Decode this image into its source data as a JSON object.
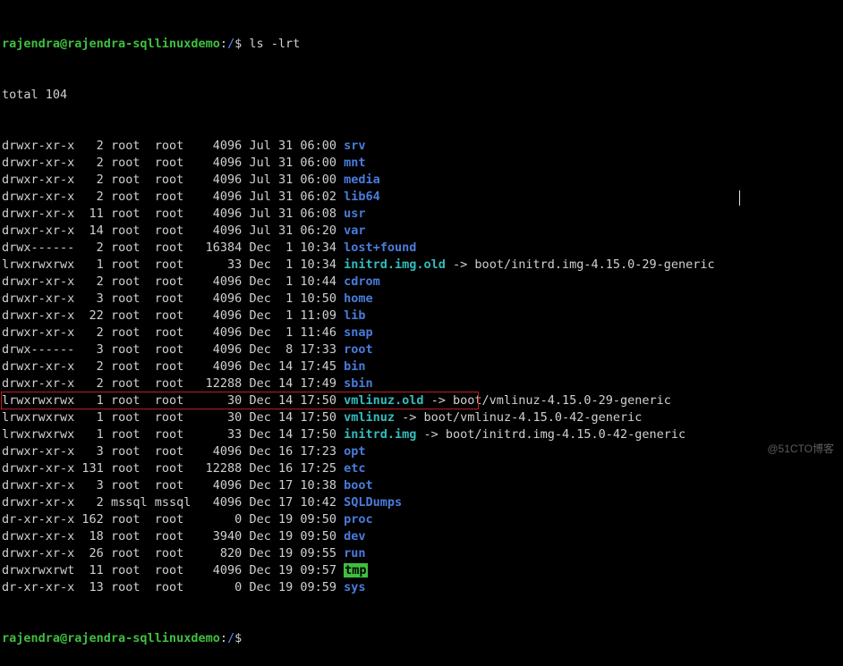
{
  "prompt": {
    "user_host": "rajendra@rajendra-sqllinuxdemo",
    "separator": ":",
    "path": "/",
    "dollar": "$",
    "command": "ls -lrt"
  },
  "total_line": "total 104",
  "rows": [
    {
      "perm": "drwxr-xr-x",
      "links": "  2",
      "owner": "root ",
      "group": "root ",
      "size": "  4096",
      "date": "Jul 31 06:00",
      "name": "srv",
      "cls": "blue"
    },
    {
      "perm": "drwxr-xr-x",
      "links": "  2",
      "owner": "root ",
      "group": "root ",
      "size": "  4096",
      "date": "Jul 31 06:00",
      "name": "mnt",
      "cls": "blue"
    },
    {
      "perm": "drwxr-xr-x",
      "links": "  2",
      "owner": "root ",
      "group": "root ",
      "size": "  4096",
      "date": "Jul 31 06:00",
      "name": "media",
      "cls": "blue"
    },
    {
      "perm": "drwxr-xr-x",
      "links": "  2",
      "owner": "root ",
      "group": "root ",
      "size": "  4096",
      "date": "Jul 31 06:02",
      "name": "lib64",
      "cls": "blue"
    },
    {
      "perm": "drwxr-xr-x",
      "links": " 11",
      "owner": "root ",
      "group": "root ",
      "size": "  4096",
      "date": "Jul 31 06:08",
      "name": "usr",
      "cls": "blue"
    },
    {
      "perm": "drwxr-xr-x",
      "links": " 14",
      "owner": "root ",
      "group": "root ",
      "size": "  4096",
      "date": "Jul 31 06:20",
      "name": "var",
      "cls": "blue"
    },
    {
      "perm": "drwx------",
      "links": "  2",
      "owner": "root ",
      "group": "root ",
      "size": " 16384",
      "date": "Dec  1 10:34",
      "name": "lost+found",
      "cls": "blue"
    },
    {
      "perm": "lrwxrwxrwx",
      "links": "  1",
      "owner": "root ",
      "group": "root ",
      "size": "    33",
      "date": "Dec  1 10:34",
      "name": "initrd.img.old",
      "cls": "cyan",
      "arrow": " -> boot/initrd.img-4.15.0-29-generic"
    },
    {
      "perm": "drwxr-xr-x",
      "links": "  2",
      "owner": "root ",
      "group": "root ",
      "size": "  4096",
      "date": "Dec  1 10:44",
      "name": "cdrom",
      "cls": "blue"
    },
    {
      "perm": "drwxr-xr-x",
      "links": "  3",
      "owner": "root ",
      "group": "root ",
      "size": "  4096",
      "date": "Dec  1 10:50",
      "name": "home",
      "cls": "blue"
    },
    {
      "perm": "drwxr-xr-x",
      "links": " 22",
      "owner": "root ",
      "group": "root ",
      "size": "  4096",
      "date": "Dec  1 11:09",
      "name": "lib",
      "cls": "blue"
    },
    {
      "perm": "drwxr-xr-x",
      "links": "  2",
      "owner": "root ",
      "group": "root ",
      "size": "  4096",
      "date": "Dec  1 11:46",
      "name": "snap",
      "cls": "blue"
    },
    {
      "perm": "drwx------",
      "links": "  3",
      "owner": "root ",
      "group": "root ",
      "size": "  4096",
      "date": "Dec  8 17:33",
      "name": "root",
      "cls": "blue"
    },
    {
      "perm": "drwxr-xr-x",
      "links": "  2",
      "owner": "root ",
      "group": "root ",
      "size": "  4096",
      "date": "Dec 14 17:45",
      "name": "bin",
      "cls": "blue"
    },
    {
      "perm": "drwxr-xr-x",
      "links": "  2",
      "owner": "root ",
      "group": "root ",
      "size": " 12288",
      "date": "Dec 14 17:49",
      "name": "sbin",
      "cls": "blue"
    },
    {
      "perm": "lrwxrwxrwx",
      "links": "  1",
      "owner": "root ",
      "group": "root ",
      "size": "    30",
      "date": "Dec 14 17:50",
      "name": "vmlinuz.old",
      "cls": "cyan",
      "arrow": " -> boot/vmlinuz-4.15.0-29-generic"
    },
    {
      "perm": "lrwxrwxrwx",
      "links": "  1",
      "owner": "root ",
      "group": "root ",
      "size": "    30",
      "date": "Dec 14 17:50",
      "name": "vmlinuz",
      "cls": "cyan",
      "arrow": " -> boot/vmlinuz-4.15.0-42-generic"
    },
    {
      "perm": "lrwxrwxrwx",
      "links": "  1",
      "owner": "root ",
      "group": "root ",
      "size": "    33",
      "date": "Dec 14 17:50",
      "name": "initrd.img",
      "cls": "cyan",
      "arrow": " -> boot/initrd.img-4.15.0-42-generic"
    },
    {
      "perm": "drwxr-xr-x",
      "links": "  3",
      "owner": "root ",
      "group": "root ",
      "size": "  4096",
      "date": "Dec 16 17:23",
      "name": "opt",
      "cls": "blue"
    },
    {
      "perm": "drwxr-xr-x",
      "links": "131",
      "owner": "root ",
      "group": "root ",
      "size": " 12288",
      "date": "Dec 16 17:25",
      "name": "etc",
      "cls": "blue"
    },
    {
      "perm": "drwxr-xr-x",
      "links": "  3",
      "owner": "root ",
      "group": "root ",
      "size": "  4096",
      "date": "Dec 17 10:38",
      "name": "boot",
      "cls": "blue"
    },
    {
      "perm": "drwxr-xr-x",
      "links": "  2",
      "owner": "mssql",
      "group": "mssql",
      "size": "  4096",
      "date": "Dec 17 10:42",
      "name": "SQLDumps",
      "cls": "blue"
    },
    {
      "perm": "dr-xr-xr-x",
      "links": "162",
      "owner": "root ",
      "group": "root ",
      "size": "     0",
      "date": "Dec 19 09:50",
      "name": "proc",
      "cls": "blue"
    },
    {
      "perm": "drwxr-xr-x",
      "links": " 18",
      "owner": "root ",
      "group": "root ",
      "size": "  3940",
      "date": "Dec 19 09:50",
      "name": "dev",
      "cls": "blue"
    },
    {
      "perm": "drwxr-xr-x",
      "links": " 26",
      "owner": "root ",
      "group": "root ",
      "size": "   820",
      "date": "Dec 19 09:55",
      "name": "run",
      "cls": "blue"
    },
    {
      "perm": "drwxrwxrwt",
      "links": " 11",
      "owner": "root ",
      "group": "root ",
      "size": "  4096",
      "date": "Dec 19 09:57",
      "name": "tmp",
      "cls": "greenbg"
    },
    {
      "perm": "dr-xr-xr-x",
      "links": " 13",
      "owner": "root ",
      "group": "root ",
      "size": "     0",
      "date": "Dec 19 09:59",
      "name": "sys",
      "cls": "blue"
    }
  ],
  "highlight_row_index": 21,
  "watermark": "@51CTO博客"
}
